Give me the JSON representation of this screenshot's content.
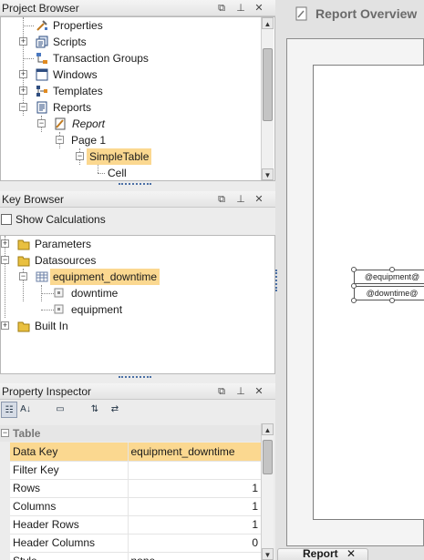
{
  "project_browser": {
    "title": "Project Browser",
    "items": [
      {
        "label": "Properties",
        "icon": "properties-icon"
      },
      {
        "label": "Scripts",
        "icon": "scripts-icon"
      },
      {
        "label": "Transaction Groups",
        "icon": "transaction-groups-icon"
      },
      {
        "label": "Windows",
        "icon": "windows-icon"
      },
      {
        "label": "Templates",
        "icon": "templates-icon"
      },
      {
        "label": "Reports",
        "icon": "reports-icon"
      },
      {
        "label": "Report",
        "icon": "report-icon"
      },
      {
        "label": "Page 1"
      },
      {
        "label": "SimpleTable"
      },
      {
        "label": "Cell"
      }
    ]
  },
  "key_browser": {
    "title": "Key Browser",
    "show_calculations_label": "Show Calculations",
    "show_calculations_checked": false,
    "items": [
      {
        "label": "Parameters",
        "icon": "folder-icon"
      },
      {
        "label": "Datasources",
        "icon": "folder-icon"
      },
      {
        "label": "equipment_downtime",
        "icon": "table-icon"
      },
      {
        "label": "downtime",
        "icon": "field-icon"
      },
      {
        "label": "equipment",
        "icon": "field-icon"
      },
      {
        "label": "Built In",
        "icon": "folder-icon"
      }
    ]
  },
  "property_inspector": {
    "title": "Property Inspector",
    "toolbar": [
      "categorized-icon",
      "sort-alpha-icon",
      "expand-icon",
      "sort-up-down-icon",
      "collapse-icon"
    ],
    "category": "Table",
    "rows": [
      {
        "name": "Data Key",
        "value": "equipment_downtime",
        "selected": true
      },
      {
        "name": "Filter Key",
        "value": ""
      },
      {
        "name": "Rows",
        "value": "1"
      },
      {
        "name": "Columns",
        "value": "1"
      },
      {
        "name": "Header Rows",
        "value": "1"
      },
      {
        "name": "Header Columns",
        "value": "0"
      },
      {
        "name": "Style",
        "value": "none"
      }
    ]
  },
  "report": {
    "tab_title": "Report Overview",
    "bottom_tab_label": "Report",
    "elements": [
      "@equipment@",
      "@downtime@"
    ]
  },
  "panel_icons": [
    "float-icon",
    "pin-icon",
    "close-icon"
  ]
}
